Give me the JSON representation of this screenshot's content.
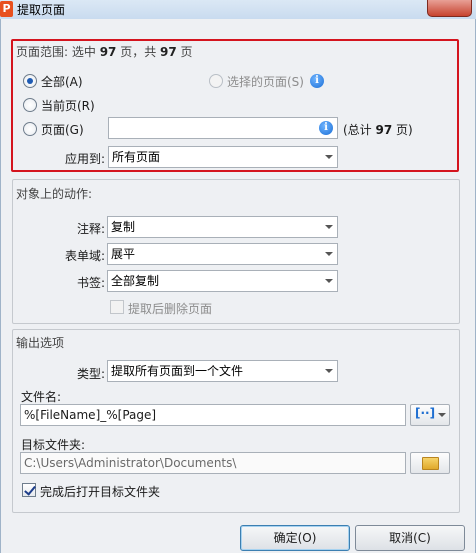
{
  "window": {
    "title": "提取页面"
  },
  "page_range": {
    "title_prefix": "页面范围: 选中 ",
    "selected_count": "97",
    "title_middle": " 页，共 ",
    "total_count": "97",
    "title_suffix": " 页",
    "all_label": "全部(A)",
    "selected_pages_label": "选择的页面(S)",
    "current_page_label": "当前页(R)",
    "pages_label": "页面(G)",
    "pages_value": "",
    "total_prefix": "(总计 ",
    "total_value": "97",
    "total_suffix": " 页)",
    "apply_to_label": "应用到:",
    "apply_to_value": "所有页面"
  },
  "object_actions": {
    "title": "对象上的动作:",
    "annotation_label": "注释:",
    "annotation_value": "复制",
    "form_field_label": "表单域:",
    "form_field_value": "展平",
    "bookmark_label": "书签:",
    "bookmark_value": "全部复制",
    "delete_after_label": "提取后删除页面"
  },
  "output": {
    "title": "输出选项",
    "type_label": "类型:",
    "type_value": "提取所有页面到一个文件",
    "filename_label": "文件名:",
    "filename_value": "%[FileName]_%[Page]",
    "target_folder_label": "目标文件夹:",
    "target_folder_value": "C:\\Users\\Administrator\\Documents\\",
    "open_folder_label": "完成后打开目标文件夹"
  },
  "buttons": {
    "ok_label": "确定(O)",
    "cancel_label": "取消(C)"
  },
  "colors": {
    "highlight_border": "#d4141e",
    "accent": "#1f5bb3"
  }
}
